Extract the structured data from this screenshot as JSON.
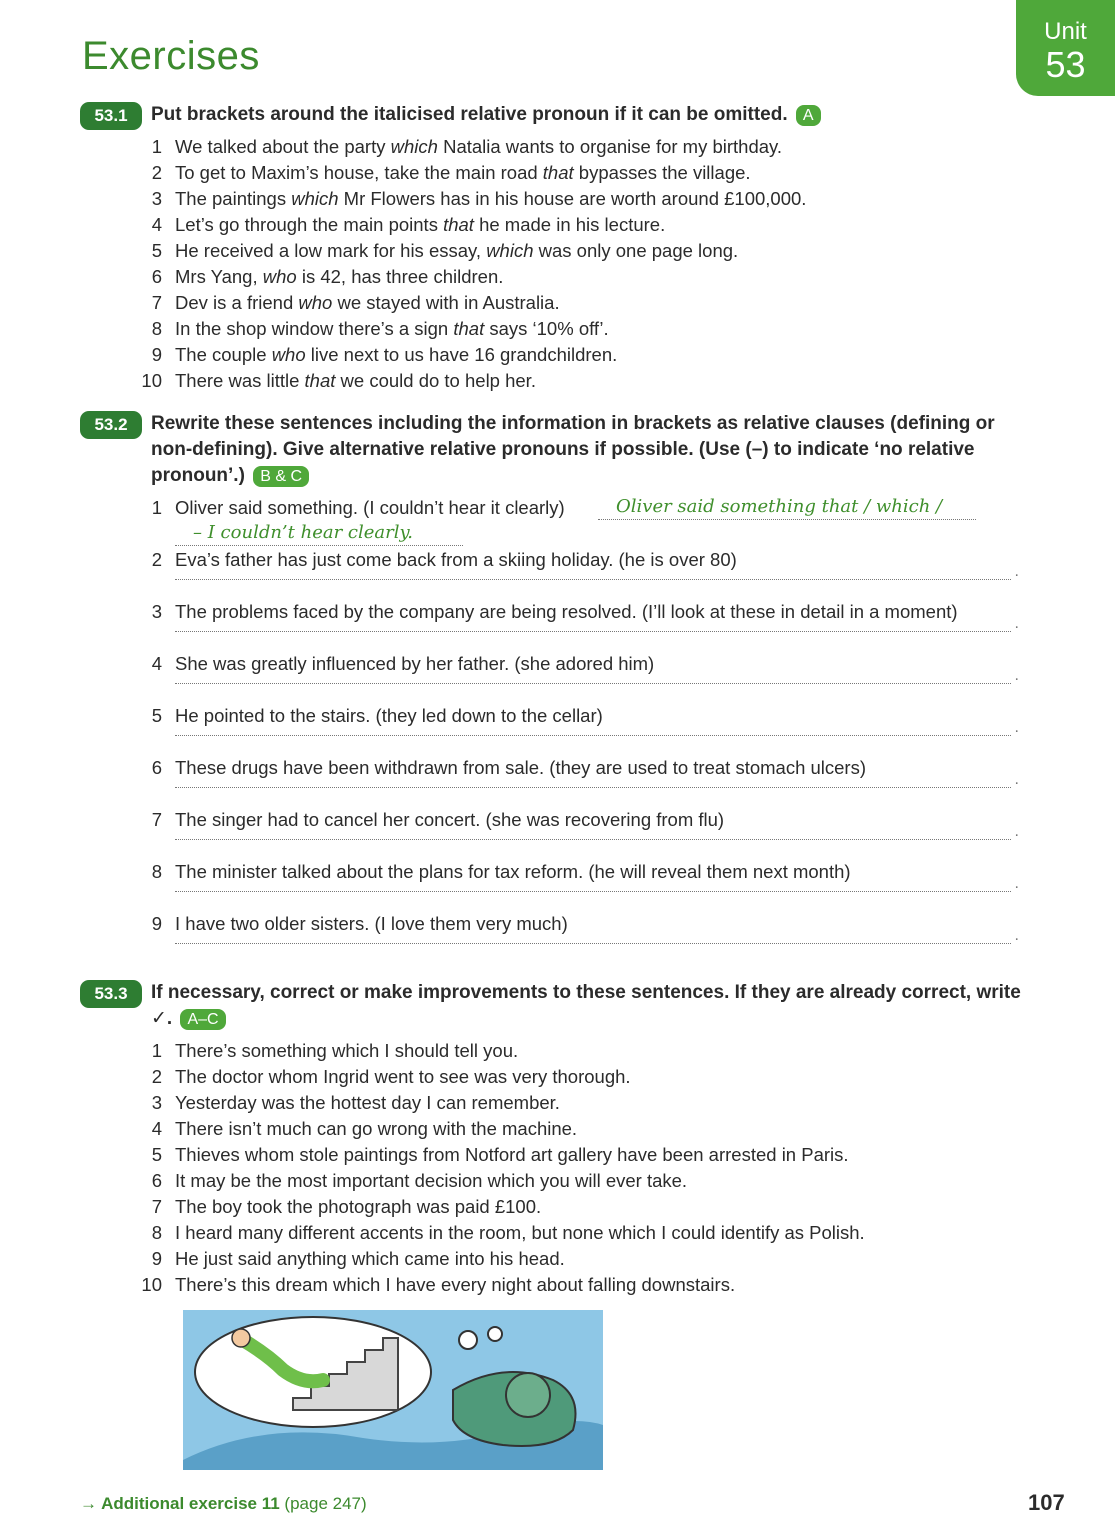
{
  "header": {
    "title": "Exercises",
    "unit_label": "Unit",
    "unit_number": "53"
  },
  "ex1": {
    "badge": "53.1",
    "instruction": "Put brackets around the italicised relative pronoun if it can be omitted.",
    "ref": "A",
    "items": [
      {
        "n": "1",
        "pre": "We talked about the party ",
        "it": "which",
        "post": " Natalia wants to organise for my birthday."
      },
      {
        "n": "2",
        "pre": "To get to Maxim’s house, take the main road ",
        "it": "that",
        "post": " bypasses the village."
      },
      {
        "n": "3",
        "pre": "The paintings ",
        "it": "which",
        "post": " Mr Flowers has in his house are worth around £100,000."
      },
      {
        "n": "4",
        "pre": "Let’s go through the main points ",
        "it": "that",
        "post": " he made in his lecture."
      },
      {
        "n": "5",
        "pre": "He received a low mark for his essay, ",
        "it": "which",
        "post": " was only one page long."
      },
      {
        "n": "6",
        "pre": "Mrs Yang, ",
        "it": "who",
        "post": " is 42, has three children."
      },
      {
        "n": "7",
        "pre": "Dev is a friend ",
        "it": "who",
        "post": " we stayed with in Australia."
      },
      {
        "n": "8",
        "pre": "In the shop window there’s a sign ",
        "it": "that",
        "post": " says ‘10% off’."
      },
      {
        "n": "9",
        "pre": "The couple ",
        "it": "who",
        "post": " live next to us have 16 grandchildren."
      },
      {
        "n": "10",
        "pre": "There was little ",
        "it": "that",
        "post": " we could do to help her."
      }
    ]
  },
  "ex2": {
    "badge": "53.2",
    "instruction": "Rewrite these sentences including the information in brackets as relative clauses (defining or non-defining). Give alternative relative pronouns if possible. (Use (–) to indicate ‘no relative pronoun’.)",
    "ref": "B & C",
    "example": {
      "n": "1",
      "text": "Oliver said something. (I couldn’t hear it clearly)",
      "answer_line1": "Oliver said something that / which /",
      "answer_line2": "– I couldn’t hear clearly."
    },
    "items": [
      {
        "n": "2",
        "text": "Eva’s father has just come back from a skiing holiday. (he is over 80)"
      },
      {
        "n": "3",
        "text": "The problems faced by the company are being resolved. (I’ll look at these in detail in a moment)"
      },
      {
        "n": "4",
        "text": "She was greatly influenced by her father. (she adored him)"
      },
      {
        "n": "5",
        "text": "He pointed to the stairs. (they led down to the cellar)"
      },
      {
        "n": "6",
        "text": "These drugs have been withdrawn from sale. (they are used to treat stomach ulcers)"
      },
      {
        "n": "7",
        "text": "The singer had to cancel her concert. (she was recovering from flu)"
      },
      {
        "n": "8",
        "text": "The minister talked about the plans for tax reform. (he will reveal them next month)"
      },
      {
        "n": "9",
        "text": "I have two older sisters. (I love them very much)"
      }
    ]
  },
  "ex3": {
    "badge": "53.3",
    "instruction": "If necessary, correct or make improvements to these sentences. If they are already correct, write ✓.",
    "ref": "A–C",
    "items": [
      {
        "n": "1",
        "text": "There’s something which I should tell you."
      },
      {
        "n": "2",
        "text": "The doctor whom Ingrid went to see was very thorough."
      },
      {
        "n": "3",
        "text": "Yesterday was the hottest day I can remember."
      },
      {
        "n": "4",
        "text": "There isn’t much can go wrong with the machine."
      },
      {
        "n": "5",
        "text": "Thieves whom stole paintings from Notford art gallery have been arrested in Paris."
      },
      {
        "n": "6",
        "text": "It may be the most important decision which you will ever take."
      },
      {
        "n": "7",
        "text": "The boy took the photograph was paid £100."
      },
      {
        "n": "8",
        "text": "I heard many different accents in the room, but none which I could identify as Polish."
      },
      {
        "n": "9",
        "text": "He just said anything which came into his head."
      },
      {
        "n": "10",
        "text": "There’s this dream which I have every night about falling downstairs."
      }
    ]
  },
  "footer": {
    "link_text": "→ Additional exercise 11",
    "link_page": "(page 247)",
    "page_number": "107"
  }
}
